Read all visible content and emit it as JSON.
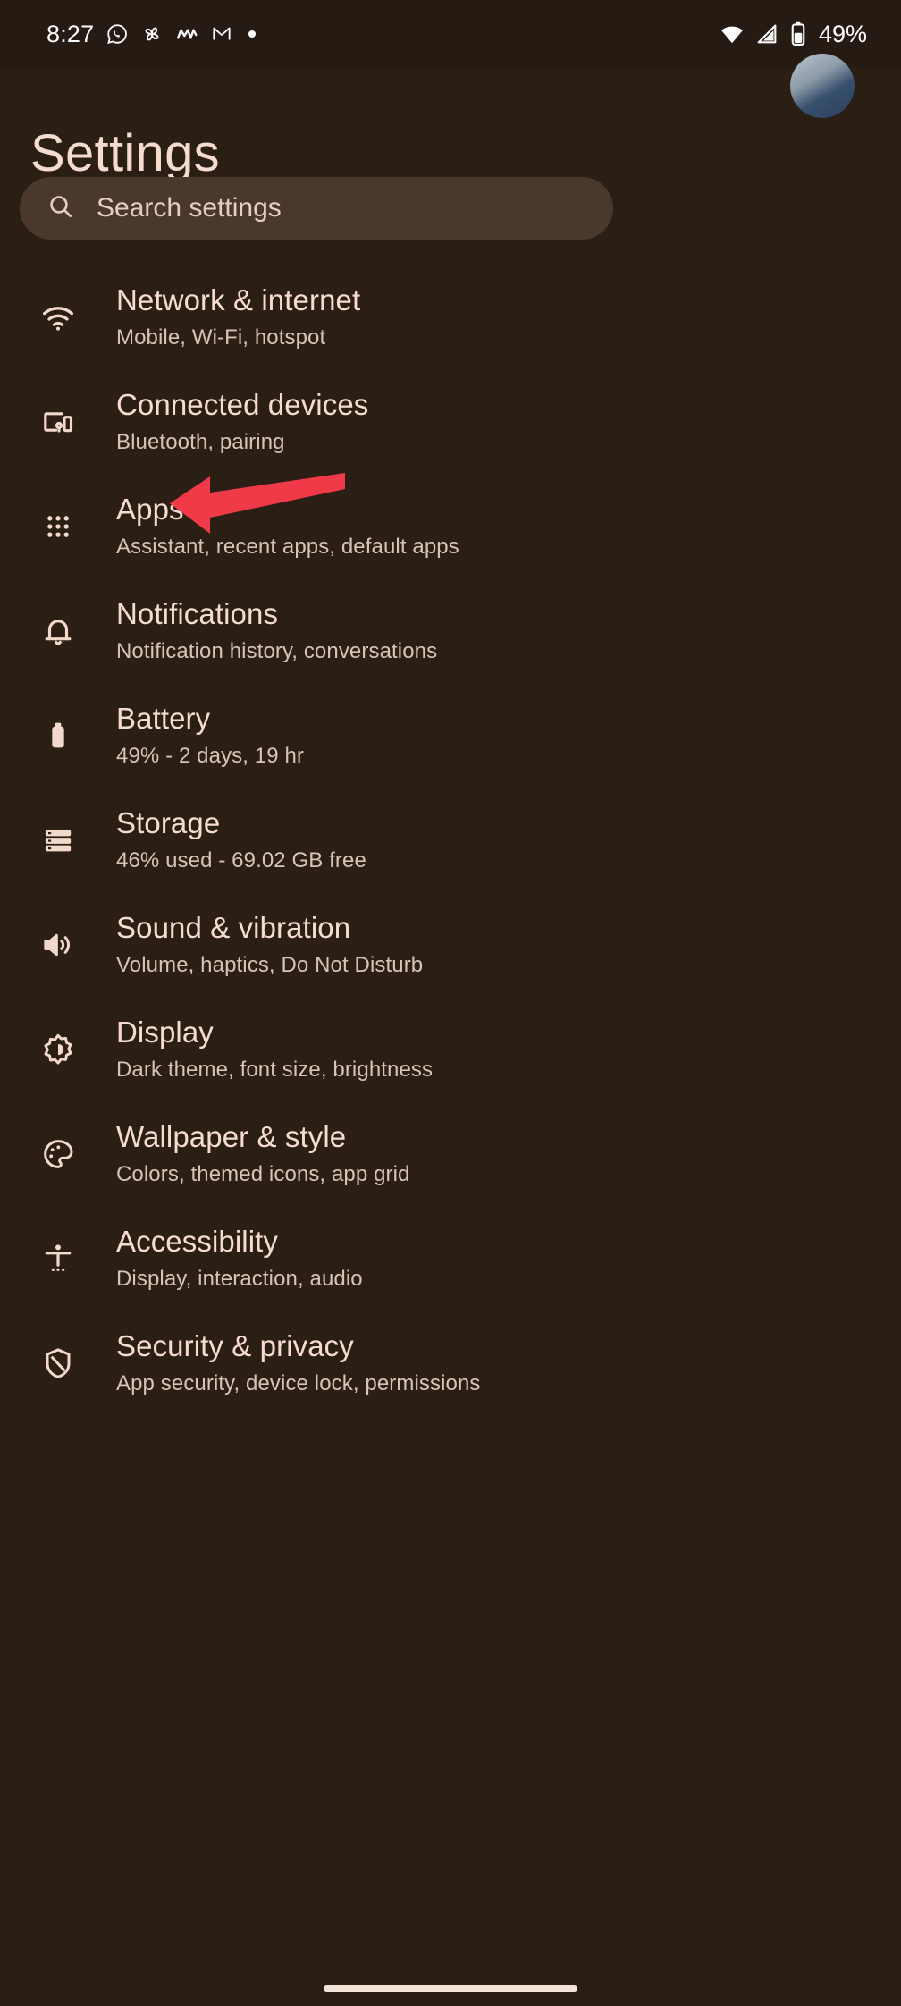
{
  "status_bar": {
    "clock": "8:27",
    "battery_percent": "49%",
    "left_icons": [
      "whatsapp-icon",
      "pinwheel-icon",
      "monzo-icon",
      "gmail-icon",
      "more-notifications-dot"
    ],
    "right_icons": [
      "wifi-icon",
      "cellular-signal-icon",
      "battery-icon"
    ]
  },
  "header": {
    "title": "Settings",
    "avatar": "user-avatar"
  },
  "search": {
    "placeholder": "Search settings",
    "icon": "search-icon"
  },
  "annotation": {
    "type": "arrow",
    "color": "#F03A47",
    "points_to": "Apps"
  },
  "colors": {
    "background": "#2A1E15",
    "status_bar_background": "#261B13",
    "title": "#F6DCCF",
    "item_title": "#F6DCCF",
    "item_subtitle": "#D8C3B6",
    "search_background": "#4A382C",
    "accent_red": "#F03A47",
    "gesture_bar": "#F3E4DA"
  },
  "list": {
    "items": [
      {
        "icon": "wifi-icon",
        "title": "Network & internet",
        "subtitle": "Mobile, Wi-Fi, hotspot"
      },
      {
        "icon": "connected-devices-icon",
        "title": "Connected devices",
        "subtitle": "Bluetooth, pairing"
      },
      {
        "icon": "apps-grid-icon",
        "title": "Apps",
        "subtitle": "Assistant, recent apps, default apps"
      },
      {
        "icon": "bell-icon",
        "title": "Notifications",
        "subtitle": "Notification history, conversations"
      },
      {
        "icon": "battery-icon",
        "title": "Battery",
        "subtitle": "49% - 2 days, 19 hr"
      },
      {
        "icon": "storage-icon",
        "title": "Storage",
        "subtitle": "46% used - 69.02 GB free"
      },
      {
        "icon": "volume-icon",
        "title": "Sound & vibration",
        "subtitle": "Volume, haptics, Do Not Disturb"
      },
      {
        "icon": "brightness-icon",
        "title": "Display",
        "subtitle": "Dark theme, font size, brightness"
      },
      {
        "icon": "palette-icon",
        "title": "Wallpaper & style",
        "subtitle": "Colors, themed icons, app grid"
      },
      {
        "icon": "accessibility-icon",
        "title": "Accessibility",
        "subtitle": "Display, interaction, audio"
      },
      {
        "icon": "shield-icon",
        "title": "Security & privacy",
        "subtitle": "App security, device lock, permissions"
      }
    ]
  },
  "navigation": {
    "gesture_bar": "home-gesture-bar"
  }
}
